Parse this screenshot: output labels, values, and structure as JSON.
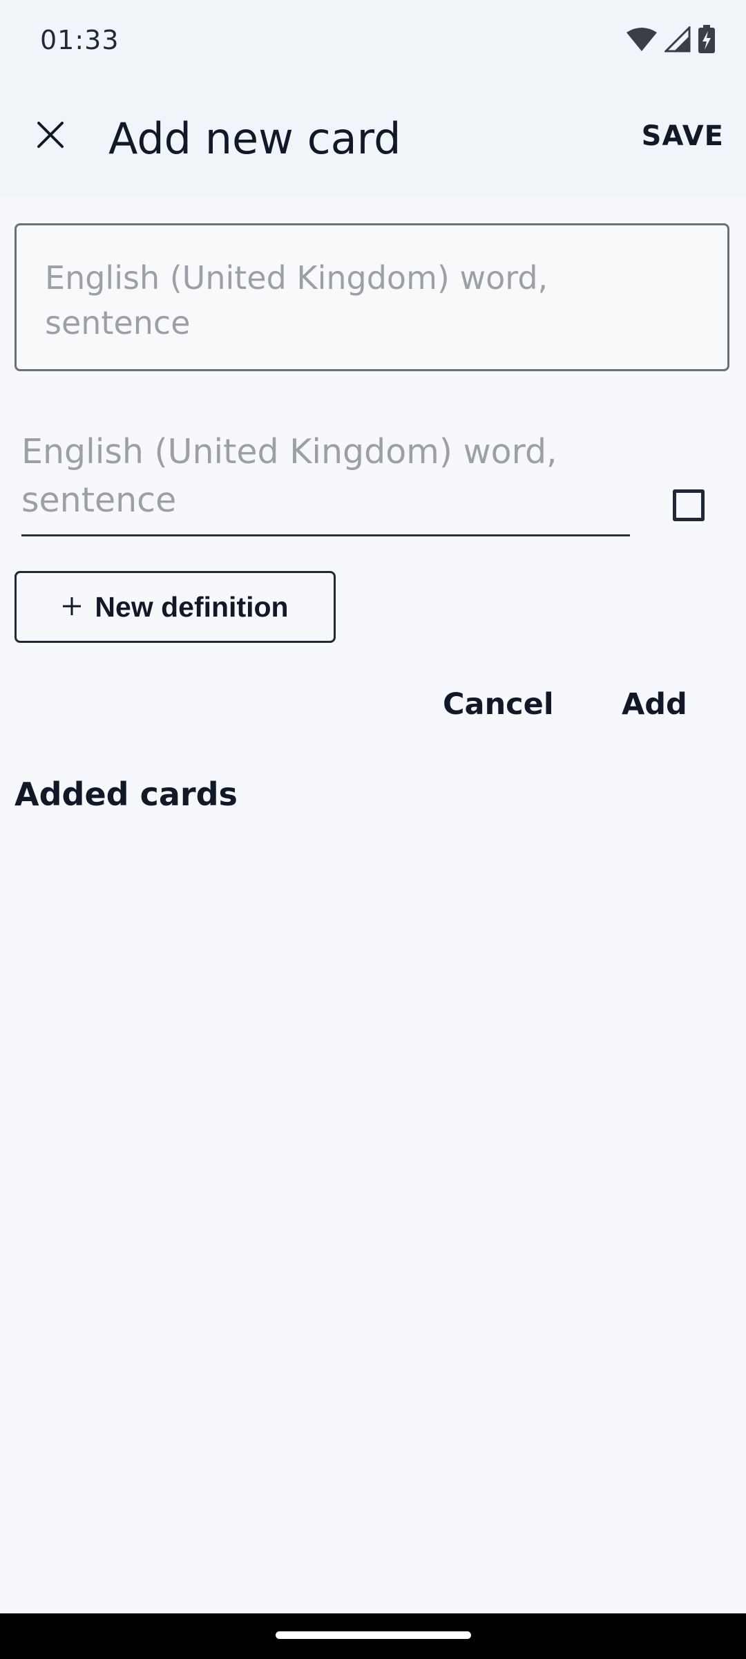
{
  "status_bar": {
    "time": "01:33",
    "icons": [
      "wifi-icon",
      "cellular-signal-icon",
      "battery-charging-icon"
    ]
  },
  "app_bar": {
    "close_icon": "close-icon",
    "title": "Add new card",
    "save_label": "SAVE"
  },
  "form": {
    "term_placeholder": "English (United Kingdom) word, sentence",
    "definition_placeholder": "English (United Kingdom) word, sentence",
    "definition_checked": false,
    "new_definition_icon": "plus-icon",
    "new_definition_label": "New definition",
    "cancel_label": "Cancel",
    "add_label": "Add"
  },
  "added_cards": {
    "title": "Added cards",
    "items": []
  },
  "colors": {
    "header_bg": "#f1f4f9",
    "page_bg": "#f7f8fb",
    "text": "#111827",
    "placeholder": "#9ca0a6"
  }
}
